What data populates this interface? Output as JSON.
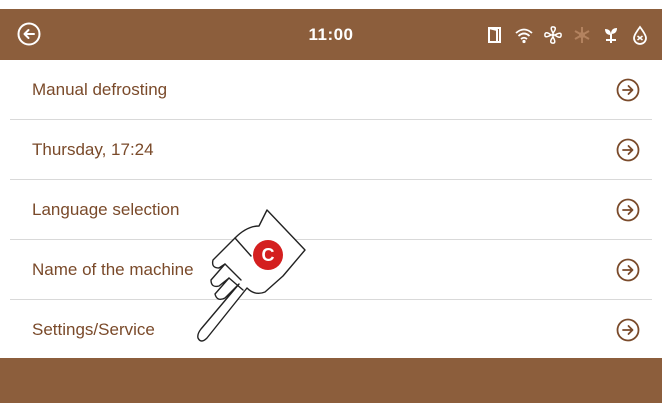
{
  "header": {
    "time": "11:00",
    "back_icon": "back-arrow-circle-icon",
    "status_icons": [
      "door-icon",
      "wifi-icon",
      "fan-icon",
      "defrost-icon",
      "plant-icon",
      "water-drop-icon"
    ]
  },
  "menu": {
    "items": [
      {
        "label": "Manual defrosting"
      },
      {
        "label": "Thursday, 17:24"
      },
      {
        "label": "Language selection"
      },
      {
        "label": "Name of the machine"
      },
      {
        "label": "Settings/Service"
      }
    ]
  },
  "overlay": {
    "badge": "C",
    "icon": "tap-hand-icon"
  },
  "colors": {
    "bar": "#8c5e3c",
    "text": "#7a4a2a",
    "badge": "#d41f1f"
  }
}
